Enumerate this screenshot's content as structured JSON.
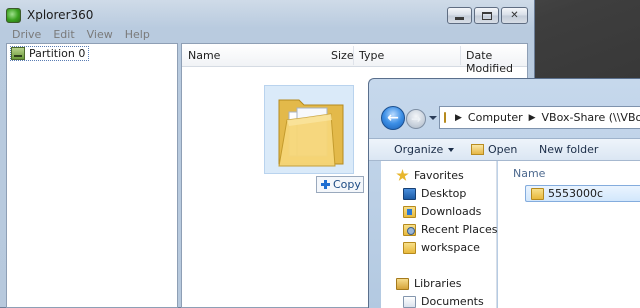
{
  "xplorer": {
    "title": "Xplorer360",
    "menu": [
      "Drive",
      "Edit",
      "View",
      "Help"
    ],
    "tree": {
      "item": "Partition 0"
    },
    "columns": {
      "name": "Name",
      "size": "Size",
      "type": "Type",
      "date_modified": "Date Modified"
    },
    "window_controls": [
      "minimize-icon",
      "maximize-icon",
      "close-icon"
    ]
  },
  "drag": {
    "tooltip": "Copy",
    "tooltip_icon": "plus-icon",
    "ghost_icon": "folder-icon"
  },
  "explorer": {
    "address": {
      "parts": [
        "Computer",
        "VBox-Share (\\\\VBoxSvr"
      ]
    },
    "toolbar": {
      "organize": "Organize",
      "open": "Open",
      "new_folder": "New folder"
    },
    "nav_pane": {
      "favorites_label": "Favorites",
      "favorites": [
        "Desktop",
        "Downloads",
        "Recent Places",
        "workspace"
      ],
      "libraries_label": "Libraries",
      "libraries": [
        "Documents"
      ]
    },
    "content": {
      "column_name": "Name",
      "items": [
        "5553000c"
      ]
    }
  },
  "colors": {
    "titlebar": "#c6d8ec",
    "selection": "#d2e7fc",
    "folder": "#e8b93c",
    "accent_blue": "#1f6fd1"
  }
}
